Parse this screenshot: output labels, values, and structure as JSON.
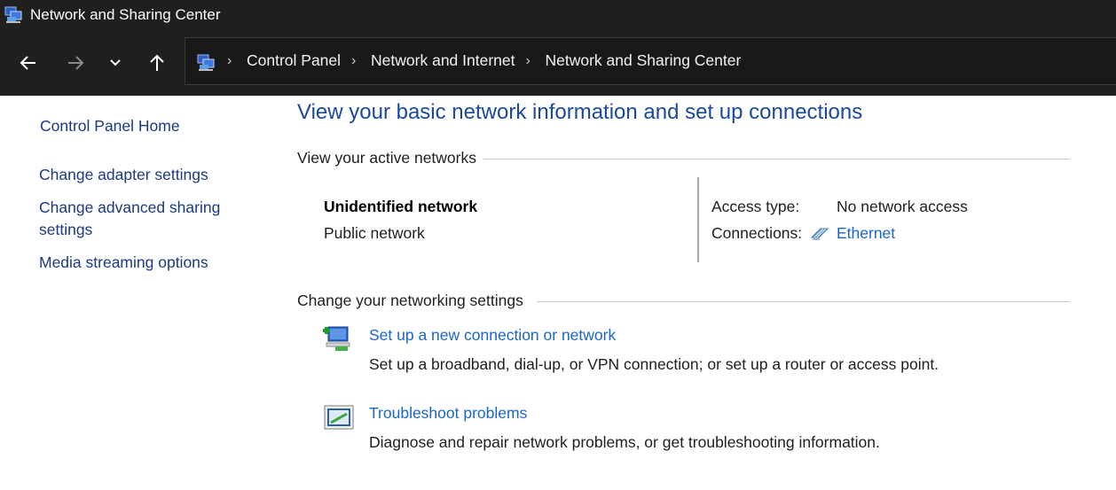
{
  "window": {
    "title": "Network and Sharing Center",
    "icon": "network-sharing-icon"
  },
  "nav": {
    "back_icon": "arrow-left-icon",
    "forward_icon": "arrow-right-icon",
    "recent_icon": "chevron-down-icon",
    "up_icon": "arrow-up-icon"
  },
  "breadcrumb": {
    "items": [
      "Control Panel",
      "Network and Internet",
      "Network and Sharing Center"
    ]
  },
  "sidebar": {
    "home": "Control Panel Home",
    "links": [
      "Change adapter settings",
      "Change advanced sharing",
      "settings",
      "Media streaming options"
    ]
  },
  "main": {
    "title": "View your basic network information and set up connections",
    "active_networks_heading": "View your active networks",
    "network": {
      "name": "Unidentified network",
      "category": "Public network",
      "access_type_label": "Access type:",
      "access_type_value": "No network access",
      "connections_label": "Connections:",
      "connection_name": "Ethernet"
    },
    "settings_heading": "Change your networking settings",
    "tasks": [
      {
        "link": "Set up a new connection or network",
        "description": "Set up a broadband, dial-up, or VPN connection; or set up a router or access point."
      },
      {
        "link": "Troubleshoot problems",
        "description": "Diagnose and repair network problems, or get troubleshooting information."
      }
    ]
  },
  "colors": {
    "titlebar": "#1f1f1f",
    "heading_blue": "#1a4a9c",
    "link_blue": "#1a66c7",
    "sidebar_link": "#1b3a82"
  }
}
